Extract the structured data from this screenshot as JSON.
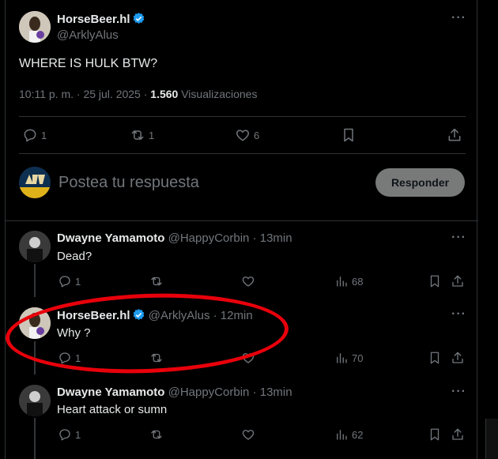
{
  "main_post": {
    "author_name": "HorseBeer.hl",
    "author_handle": "@ArklyAlus",
    "text": "WHERE IS HULK BTW?",
    "time": "10:11 p. m. · 25 jul. 2025 · ",
    "views_count": "1.560",
    "views_label": " Visualizaciones",
    "replies": "1",
    "reposts": "1",
    "likes": "6"
  },
  "composer": {
    "placeholder": "Postea tu respuesta",
    "reply_label": "Responder"
  },
  "replies": [
    {
      "author_name": "Dwayne Yamamoto",
      "author_handle": "@HappyCorbin",
      "age": "· 13min",
      "text": "Dead?",
      "replies": "1",
      "views": "68"
    },
    {
      "author_name": "HorseBeer.hl",
      "author_handle": "@ArklyAlus",
      "age": "· 12min",
      "text": "Why ?",
      "replies": "1",
      "views": "70"
    },
    {
      "author_name": "Dwayne Yamamoto",
      "author_handle": "@HappyCorbin",
      "age": "· 13min",
      "text": "Heart attack or sumn",
      "replies": "1",
      "views": "62"
    }
  ],
  "colors": {
    "verified": "#1d9bf0",
    "annotation": "#e8000b"
  }
}
